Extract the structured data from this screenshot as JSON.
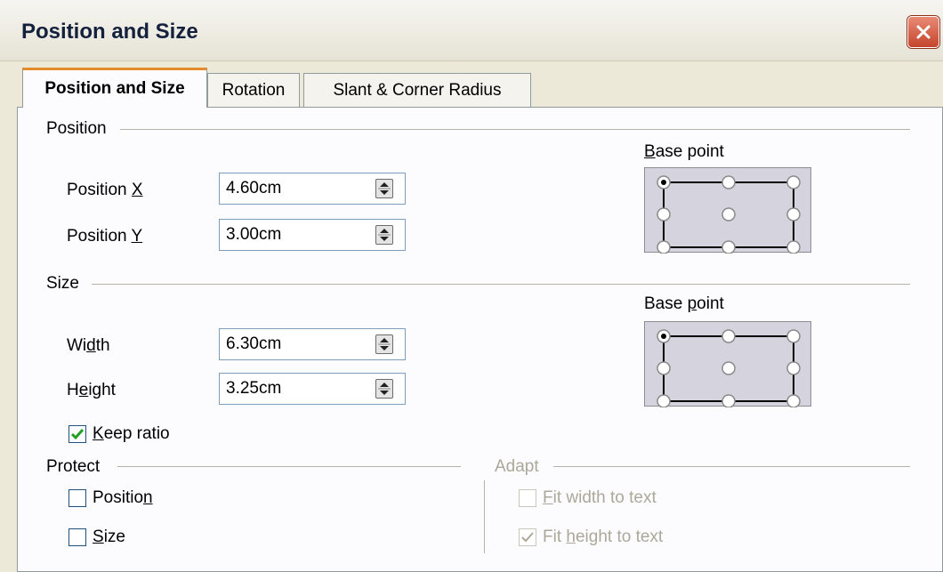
{
  "window": {
    "title": "Position and Size"
  },
  "tabs": [
    {
      "label": "Position and Size",
      "active": true
    },
    {
      "label": "Rotation",
      "active": false
    },
    {
      "label": "Slant & Corner Radius",
      "active": false
    }
  ],
  "position": {
    "section_label": "Position",
    "x": {
      "label_pre": "Position ",
      "mnemonic": "X",
      "label_post": "",
      "value": "4.60cm"
    },
    "y": {
      "label_pre": "Position ",
      "mnemonic": "Y",
      "label_post": "",
      "value": "3.00cm"
    },
    "base_point": {
      "label_pre": "",
      "mnemonic": "B",
      "label_post": "ase point",
      "selected": "top-left"
    }
  },
  "size": {
    "section_label": "Size",
    "width": {
      "label_pre": "Wi",
      "mnemonic": "d",
      "label_post": "th",
      "value": "6.30cm"
    },
    "height": {
      "label_pre": "H",
      "mnemonic": "e",
      "label_post": "ight",
      "value": "3.25cm"
    },
    "keep_ratio": {
      "label_pre": "",
      "mnemonic": "K",
      "label_post": "eep ratio",
      "checked": true
    },
    "base_point": {
      "label_pre": "Base ",
      "mnemonic": "p",
      "label_post": "oint",
      "selected": "top-left"
    }
  },
  "protect": {
    "section_label": "Protect",
    "position": {
      "label_pre": "Positio",
      "mnemonic": "n",
      "label_post": "",
      "checked": false
    },
    "size": {
      "label_pre": "",
      "mnemonic": "S",
      "label_post": "ize",
      "checked": false
    }
  },
  "adapt": {
    "section_label": "Adapt",
    "fit_width": {
      "label_pre": "",
      "mnemonic": "F",
      "label_post": "it width to text",
      "checked": false,
      "enabled": false
    },
    "fit_height": {
      "label_pre": "Fit ",
      "mnemonic": "h",
      "label_post": "eight to text",
      "checked": true,
      "enabled": false
    }
  },
  "icons": {
    "close": "close-icon",
    "spin": "spin-arrows-icon",
    "check": "checkmark-icon",
    "radio_grid": "base-point-grid"
  },
  "colors": {
    "accent_tab": "#e68b2c",
    "close_button": "#c4452b",
    "checkmark": "#21a121",
    "disabled": "#aca899"
  }
}
